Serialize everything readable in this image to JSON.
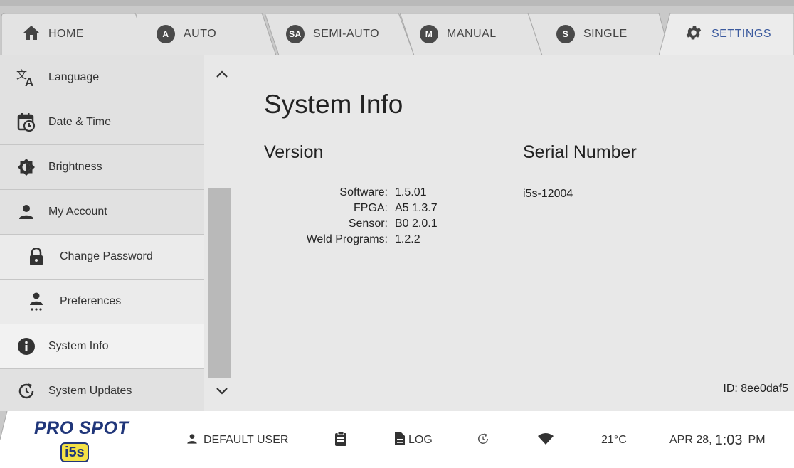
{
  "tabs": [
    {
      "label": "HOME",
      "badge": "",
      "icon": "home-icon"
    },
    {
      "label": "AUTO",
      "badge": "A",
      "icon": "auto-badge-icon"
    },
    {
      "label": "SEMI-AUTO",
      "badge": "SA",
      "icon": "semi-auto-badge-icon"
    },
    {
      "label": "MANUAL",
      "badge": "M",
      "icon": "manual-badge-icon"
    },
    {
      "label": "SINGLE",
      "badge": "S",
      "icon": "single-badge-icon"
    },
    {
      "label": "SETTINGS",
      "badge": "",
      "icon": "gear-icon"
    }
  ],
  "active_tab": "SETTINGS",
  "sidebar": {
    "items": [
      {
        "label": "Language",
        "icon": "translate-icon"
      },
      {
        "label": "Date & Time",
        "icon": "calendar-clock-icon"
      },
      {
        "label": "Brightness",
        "icon": "brightness-icon"
      },
      {
        "label": "My Account",
        "icon": "person-icon"
      },
      {
        "label": "Change Password",
        "icon": "lock-icon"
      },
      {
        "label": "Preferences",
        "icon": "person-settings-icon"
      },
      {
        "label": "System Info",
        "icon": "info-icon"
      },
      {
        "label": "System Updates",
        "icon": "update-icon"
      }
    ],
    "active_item": "System Info"
  },
  "main": {
    "title": "System Info",
    "version": {
      "heading": "Version",
      "rows": [
        {
          "key": "Software:",
          "value": "1.5.01"
        },
        {
          "key": "FPGA:",
          "value": "A5 1.3.7"
        },
        {
          "key": "Sensor:",
          "value": "B0 2.0.1"
        },
        {
          "key": "Weld Programs:",
          "value": "1.2.2"
        }
      ]
    },
    "serial": {
      "heading": "Serial Number",
      "value": "i5s-12004"
    },
    "device_id": "ID: 8ee0daf5"
  },
  "statusbar": {
    "logo_text": "PRO SPOT",
    "logo_sub": "i5s",
    "user": "DEFAULT USER",
    "log": "LOG",
    "temperature": "21°C",
    "date": "APR 28,",
    "time": "1:03",
    "ampm": "PM"
  },
  "colors": {
    "accent": "#3b5a9e",
    "brand": "#20367a",
    "badge": "#4a4a4a"
  }
}
